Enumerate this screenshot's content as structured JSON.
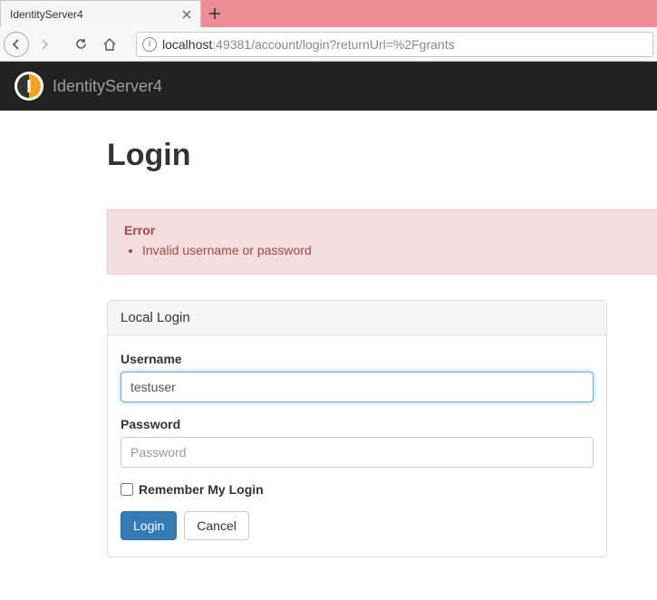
{
  "browser": {
    "tab_title": "IdentityServer4",
    "url_host": "localhost",
    "url_path": ":49381/account/login?returnUrl=%2Fgrants"
  },
  "brand": {
    "name": "IdentityServer4"
  },
  "page": {
    "title": "Login"
  },
  "alert": {
    "title": "Error",
    "messages": [
      "Invalid username or password"
    ]
  },
  "panel": {
    "heading": "Local Login"
  },
  "form": {
    "username_label": "Username",
    "username_value": "testuser",
    "password_label": "Password",
    "password_placeholder": "Password",
    "remember_label": "Remember My Login",
    "login_button": "Login",
    "cancel_button": "Cancel"
  }
}
